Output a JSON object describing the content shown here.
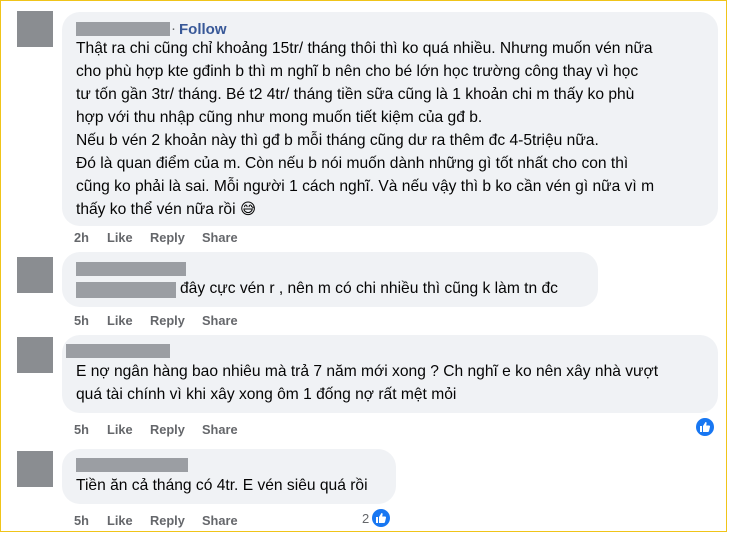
{
  "comments": [
    {
      "follow_label": "Follow",
      "separator": "·",
      "lines": [
        "Thật ra chi cũng chỉ khoảng 15tr/ tháng thôi thì ko quá nhiều. Nhưng muốn vén nữa",
        "cho phù hợp kte gđinh b thì m nghĩ b nên cho bé lớn học trường công thay vì học",
        "tư tốn gần 3tr/ tháng. Bé t2 4tr/ tháng tiền sữa cũng là 1 khoản chi m thấy ko phù",
        "hợp với thu nhập cũng như mong muốn tiết kiệm của gđ b.",
        "Nếu b vén 2 khoản này thì gđ b mỗi tháng cũng dư ra thêm đc 4-5triệu nữa.",
        "Đó là quan điểm của m. Còn nếu b nói muốn dành những gì tốt nhất cho con thì",
        "cũng ko phải là sai. Mỗi người 1 cách nghĩ. Và nếu vậy thì b ko cần vén gì nữa vì m",
        "thấy ko thể vén nữa rồi 😅"
      ],
      "time": "2h",
      "like": "Like",
      "reply": "Reply",
      "share": "Share"
    },
    {
      "lines": [
        "đây cực vén r , nên m có chi nhiều thì cũng k làm tn đc"
      ],
      "time": "5h",
      "like": "Like",
      "reply": "Reply",
      "share": "Share"
    },
    {
      "lines": [
        "E nợ ngân hàng bao nhiêu mà trả 7 năm mới xong ? Ch nghĩ e ko nên xây nhà vượt",
        "quá tài chính vì khi xây xong ôm 1 đống nợ rất mệt mỏi"
      ],
      "time": "5h",
      "like": "Like",
      "reply": "Reply",
      "share": "Share",
      "reaction": "like-icon"
    },
    {
      "lines": [
        "Tiền ăn cả tháng có 4tr. E vén siêu quá rồi"
      ],
      "time": "5h",
      "like": "Like",
      "reply": "Reply",
      "share": "Share",
      "reaction": "like-icon",
      "reaction_count": "2"
    }
  ],
  "colors": {
    "bubble": "#f0f2f5",
    "meta": "#65676b",
    "follow": "#385898",
    "like_badge": "#1877f2",
    "frame": "#f0c419"
  }
}
